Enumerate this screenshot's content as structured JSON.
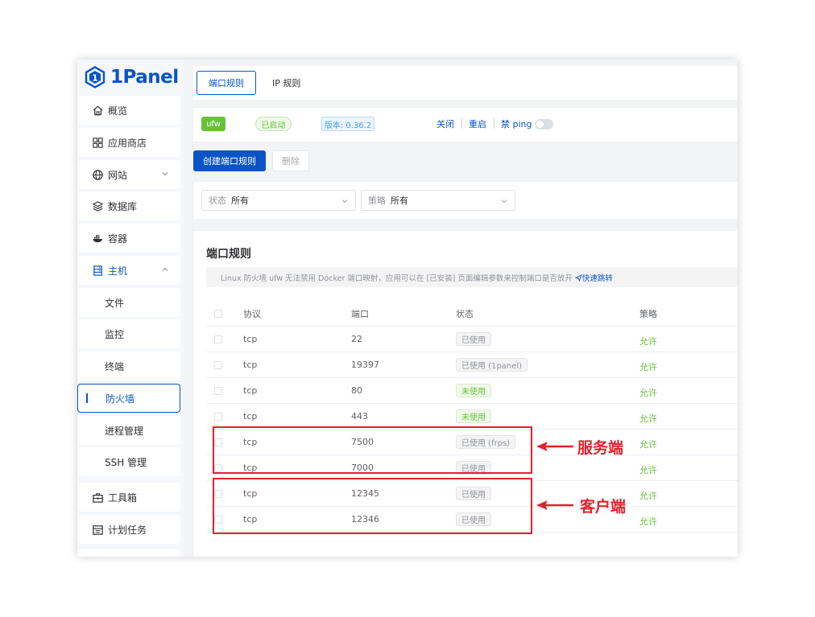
{
  "app": {
    "logo_text": "1Panel"
  },
  "sidebar": {
    "items": [
      {
        "label": "概览",
        "icon": "home-icon"
      },
      {
        "label": "应用商店",
        "icon": "apps-grid-icon"
      },
      {
        "label": "网站",
        "icon": "globe-icon",
        "expandable": true
      },
      {
        "label": "数据库",
        "icon": "layers-icon"
      },
      {
        "label": "容器",
        "icon": "docker-icon"
      },
      {
        "label": "主机",
        "icon": "server-icon",
        "expanded": true
      },
      {
        "label": "文件"
      },
      {
        "label": "监控"
      },
      {
        "label": "终端"
      },
      {
        "label": "防火墙",
        "active": true
      },
      {
        "label": "进程管理"
      },
      {
        "label": "SSH 管理"
      },
      {
        "label": "工具箱",
        "icon": "toolbox-icon"
      },
      {
        "label": "计划任务",
        "icon": "calendar-icon"
      }
    ]
  },
  "tabs": [
    {
      "label": "端口规则",
      "active": true
    },
    {
      "label": "IP 规则",
      "active": false
    }
  ],
  "status_bar": {
    "ufw_tag": "ufw",
    "state_tag": "已启动",
    "version_tag": "版本: 0.36.2",
    "actions": {
      "close": "关闭",
      "restart": "重启",
      "ping": "禁 ping"
    },
    "ping_toggle_on": false
  },
  "toolbar": {
    "create_label": "创建端口规则",
    "delete_label": "删除"
  },
  "filters": {
    "status": {
      "label": "状态",
      "value": "所有"
    },
    "policy": {
      "label": "策略",
      "value": "所有"
    }
  },
  "rules": {
    "title": "端口规则",
    "notice_text": "Linux 防火墙 ufw 无法禁用 Docker 端口映射，应用可以在 [已安装] 页面编辑参数来控制端口是否放开",
    "notice_link": "快速跳转",
    "columns": [
      "协议",
      "端口",
      "状态",
      "策略"
    ],
    "rows": [
      {
        "protocol": "tcp",
        "port": "22",
        "status": "已使用",
        "status_type": "used",
        "policy": "允许"
      },
      {
        "protocol": "tcp",
        "port": "19397",
        "status": "已使用 (1panel)",
        "status_type": "used",
        "policy": "允许"
      },
      {
        "protocol": "tcp",
        "port": "80",
        "status": "未使用",
        "status_type": "free",
        "policy": "允许"
      },
      {
        "protocol": "tcp",
        "port": "443",
        "status": "未使用",
        "status_type": "free",
        "policy": "允许"
      },
      {
        "protocol": "tcp",
        "port": "7500",
        "status": "已使用 (frps)",
        "status_type": "used",
        "policy": "允许"
      },
      {
        "protocol": "tcp",
        "port": "7000",
        "status": "已使用",
        "status_type": "used",
        "policy": "允许"
      },
      {
        "protocol": "tcp",
        "port": "12345",
        "status": "已使用",
        "status_type": "used",
        "policy": "允许"
      },
      {
        "protocol": "tcp",
        "port": "12346",
        "status": "已使用",
        "status_type": "used",
        "policy": "允许"
      }
    ]
  },
  "annotations": {
    "server_label": "服务端",
    "client_label": "客户端",
    "color": "#e3222c"
  },
  "colors": {
    "primary": "#0854c7",
    "success": "#67c23a"
  }
}
